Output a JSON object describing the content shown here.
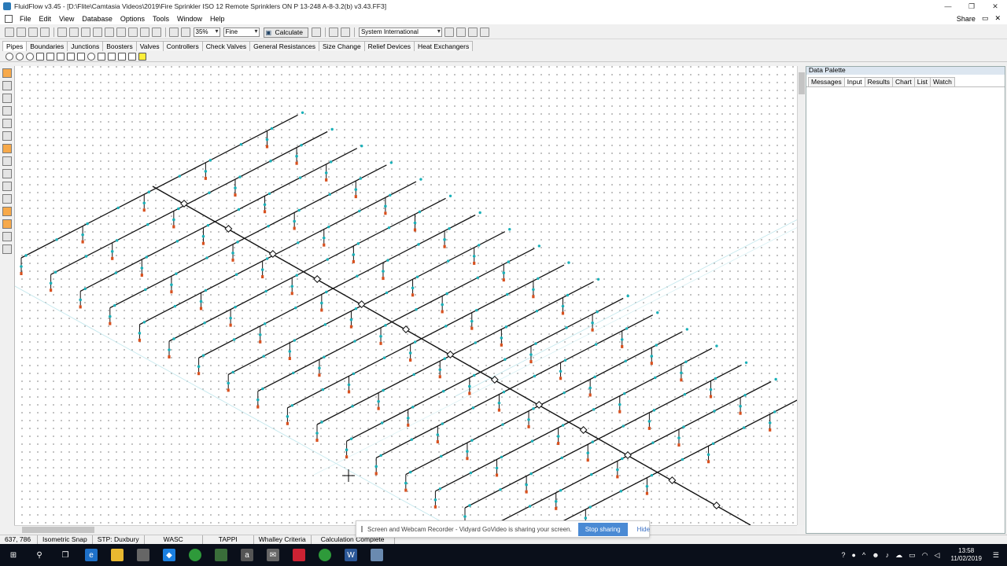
{
  "window": {
    "title": "FluidFlow v3.45 - [D:\\Flite\\Camtasia Videos\\2019\\Fire Sprinkler ISO 12 Remote Sprinklers ON P 13-248 A-8-3.2(b) v3.43.FF3]",
    "controls": [
      "—",
      "❐",
      "✕"
    ]
  },
  "menubar": {
    "items": [
      "File",
      "Edit",
      "View",
      "Database",
      "Options",
      "Tools",
      "Window",
      "Help"
    ],
    "share_label": "Share"
  },
  "toolbar": {
    "zoom": "35%",
    "quality": "Fine",
    "calculate": "Calculate",
    "units": "System International"
  },
  "component_tabs": [
    "Pipes",
    "Boundaries",
    "Junctions",
    "Boosters",
    "Valves",
    "Controllers",
    "Check Valves",
    "General Resistances",
    "Size Change",
    "Relief Devices",
    "Heat Exchangers"
  ],
  "palette": {
    "title": "Data Palette",
    "tabs": [
      "Messages",
      "Input",
      "Results",
      "Chart",
      "List",
      "Watch"
    ],
    "active_tab": "Input"
  },
  "status": {
    "coords": "637, 786",
    "items": [
      "Isometric Snap",
      "STP: Duxbury",
      "WASC",
      "TAPPI",
      "Whalley Criteria",
      "Calculation Complete"
    ]
  },
  "share_banner": {
    "message": "Screen and Webcam Recorder - Vidyard GoVideo is sharing your screen.",
    "stop": "Stop sharing",
    "hide": "Hide"
  },
  "taskbar": {
    "time": "13:58",
    "date": "11/02/2019"
  },
  "colors": {
    "pipe": "#111111",
    "node": "#1ab0b8",
    "sprinkler_head": "#d8501e",
    "accent_highlight": "#f7a94a",
    "stop_button": "#4a8ad4"
  }
}
